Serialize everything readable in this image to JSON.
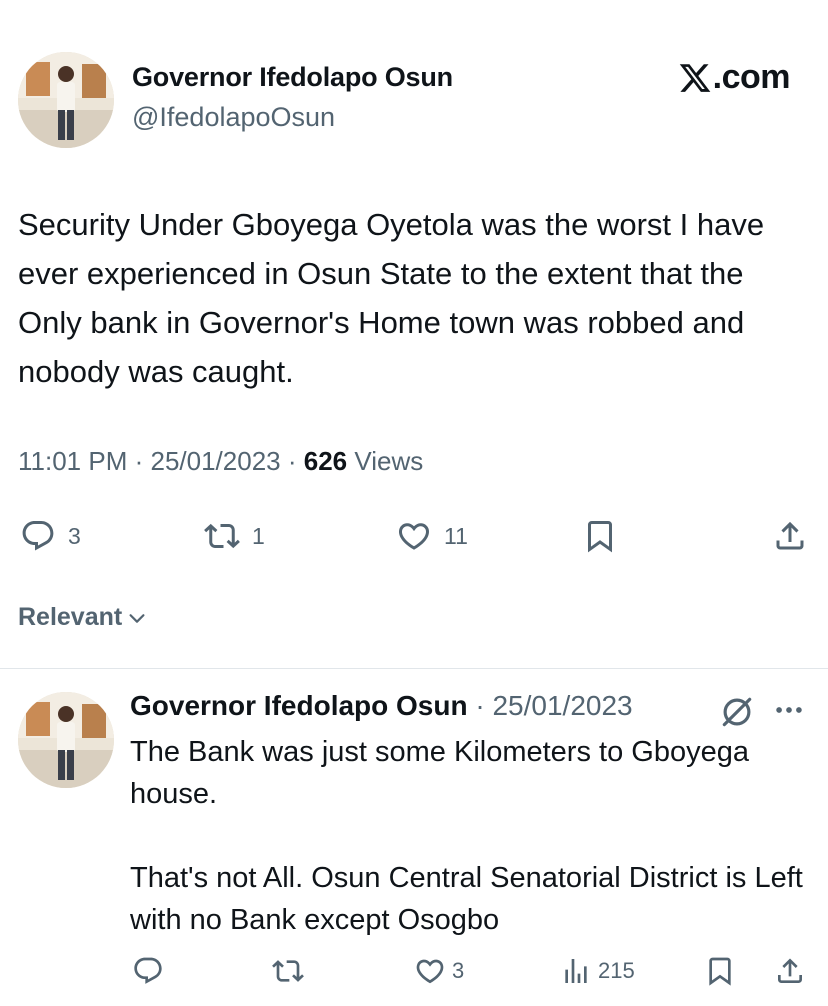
{
  "brand": {
    "label": ".com"
  },
  "main_tweet": {
    "author_name": "Governor Ifedolapo Osun",
    "handle": "@IfedolapoOsun",
    "text": "Security Under Gboyega Oyetola was the worst I have ever experienced in Osun State to the extent that the Only bank in Governor's Home town was robbed and nobody was caught.",
    "time": "11:01 PM",
    "date": "25/01/2023",
    "views_count": "626",
    "views_label": "Views",
    "replies": "3",
    "reposts": "1",
    "likes": "11"
  },
  "sort": {
    "label": "Relevant"
  },
  "reply": {
    "author_name": "Governor Ifedolapo Osun",
    "date": "25/01/2023",
    "paragraph_1": "The Bank was just some Kilometers to Gboyega house.",
    "paragraph_2": "That's not All. Osun Central Senatorial District is Left with no Bank except Osogbo",
    "likes": "3",
    "views": "215"
  },
  "colors": {
    "text_primary": "#0f1419",
    "text_secondary": "#536471",
    "divider": "#e1e6ea",
    "background": "#ffffff"
  },
  "icons": [
    "x-logo-icon",
    "reply-icon",
    "repost-icon",
    "like-icon",
    "bookmark-icon",
    "share-icon",
    "chevron-down-icon",
    "grok-icon",
    "more-icon",
    "views-icon"
  ]
}
